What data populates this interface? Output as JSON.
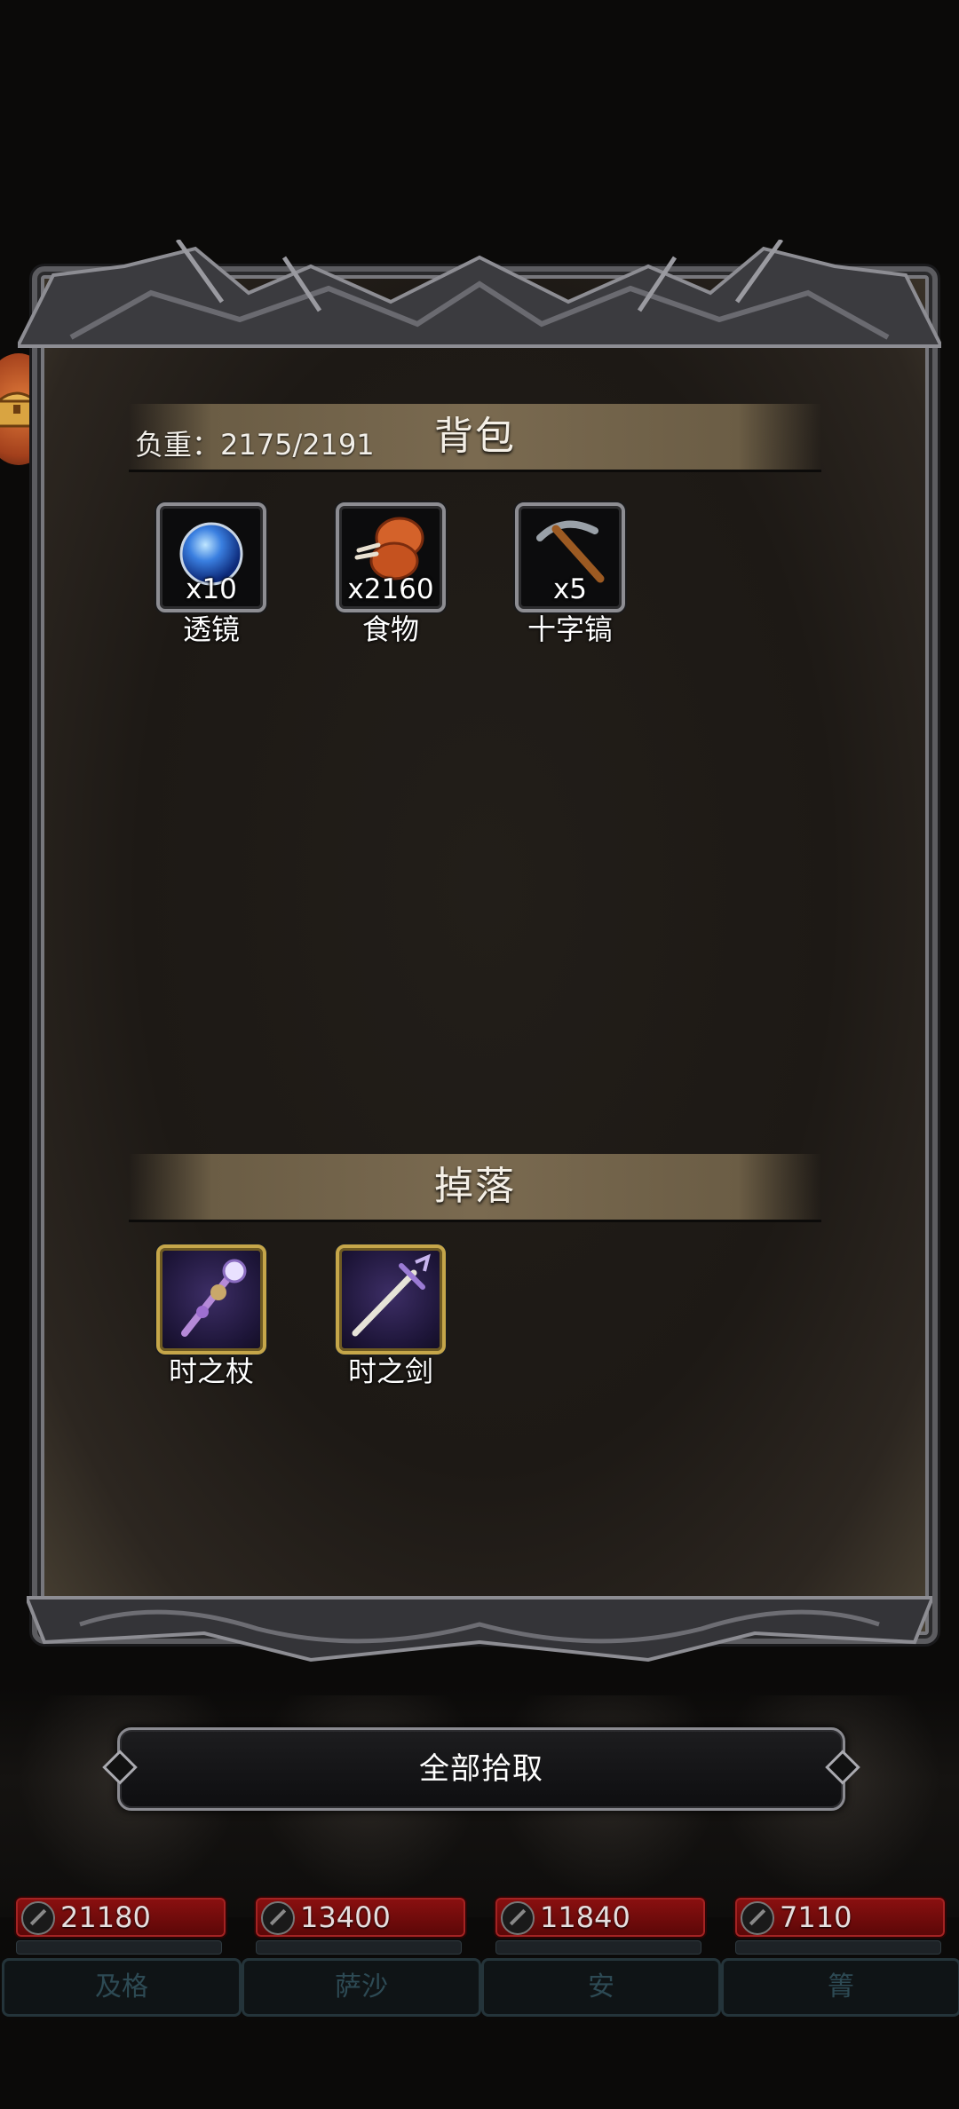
{
  "inventory": {
    "weight_label": "负重：2175/2191",
    "bag_title": "背包",
    "drop_title": "掉落",
    "bag_items": [
      {
        "name": "透镜",
        "count": "x10",
        "icon": "lens-icon"
      },
      {
        "name": "食物",
        "count": "x2160",
        "icon": "food-icon"
      },
      {
        "name": "十字镐",
        "count": "x5",
        "icon": "pickaxe-icon"
      }
    ],
    "drop_items": [
      {
        "name": "时之杖",
        "icon": "staff-icon"
      },
      {
        "name": "时之剑",
        "icon": "sword-icon"
      }
    ]
  },
  "actions": {
    "pickup_all_label": "全部拾取"
  },
  "party": [
    {
      "hp": "21180",
      "name": "及格"
    },
    {
      "hp": "13400",
      "name": "萨沙"
    },
    {
      "hp": "11840",
      "name": "安"
    },
    {
      "hp": "7110",
      "name": "箐"
    }
  ],
  "colors": {
    "hp_bar": "#8b1010",
    "gold_frame": "#c5a64a",
    "panel_bg": "#1d1915",
    "section_bar": "#7a6a50"
  }
}
